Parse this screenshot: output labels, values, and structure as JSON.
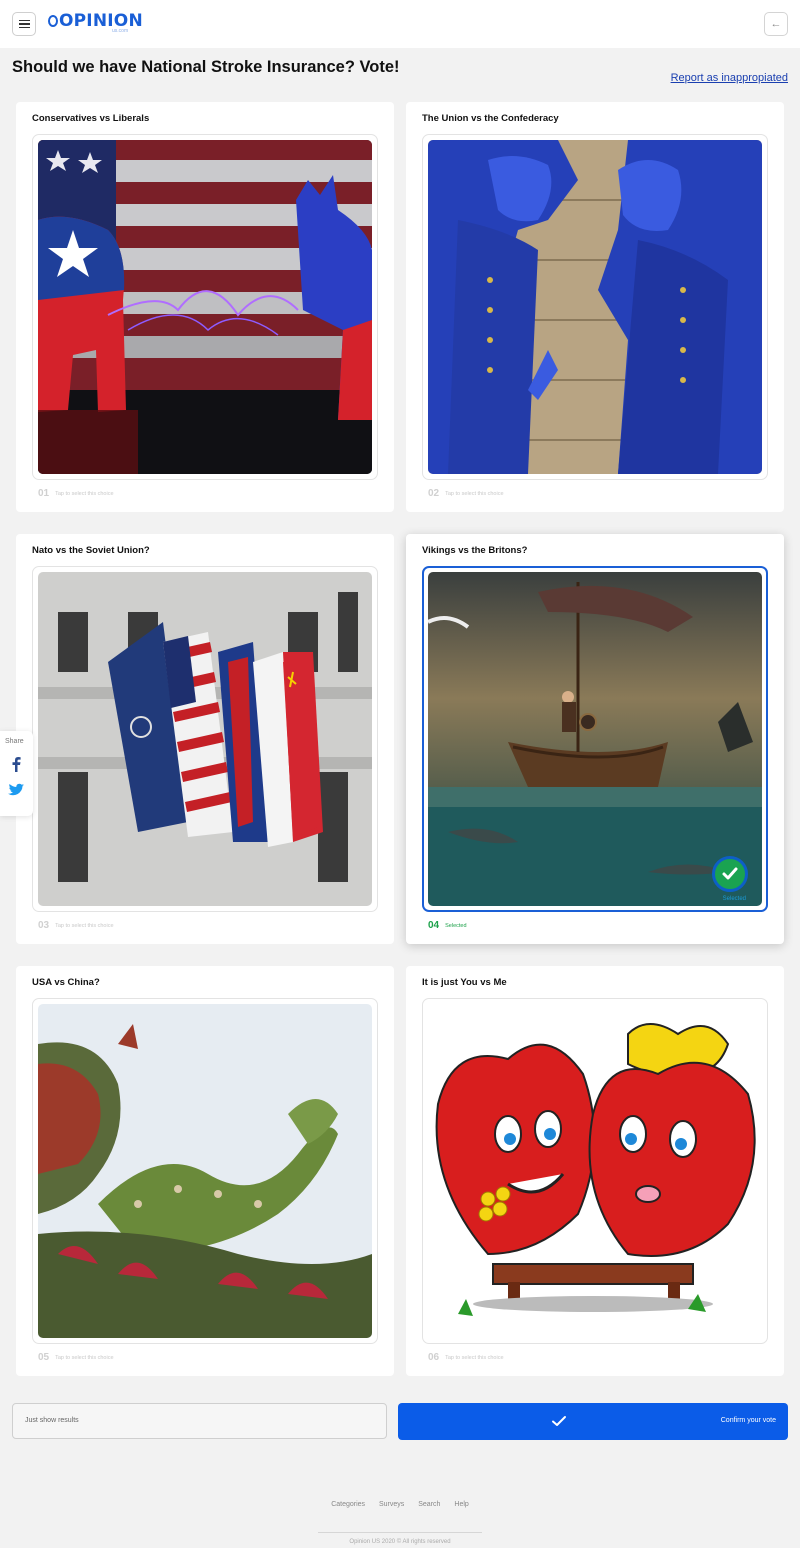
{
  "header": {
    "logo_text": "OPINION",
    "logo_sub": "us.com",
    "back_icon": "arrow-left-icon",
    "menu_icon": "hamburger-menu-icon"
  },
  "page": {
    "title": "Should we have National Stroke Insurance? Vote!",
    "report_link": "Report as inappropiated"
  },
  "choices": [
    {
      "number": "01",
      "title": "Conservatives vs Liberals",
      "hint": "Tap to select this choice",
      "image": "elephant-vs-donkey-flag"
    },
    {
      "number": "02",
      "title": "The Union vs the Confederacy",
      "hint": "Tap to select this choice",
      "image": "civil-war-mural"
    },
    {
      "number": "03",
      "title": "Nato vs the Soviet Union?",
      "hint": "Tap to select this choice",
      "image": "flags-on-building"
    },
    {
      "number": "04",
      "title": "Vikings vs the Britons?",
      "hint": "Selected",
      "image": "viking-ship-at-sea",
      "selected": true,
      "badge_label": "Selected"
    },
    {
      "number": "05",
      "title": "USA vs China?",
      "hint": "Tap to select this choice",
      "image": "dragon-sculpture"
    },
    {
      "number": "06",
      "title": "It is just You vs Me",
      "hint": "Tap to select this choice",
      "image": "cartoon-hearts"
    }
  ],
  "share": {
    "label": "Share",
    "icons": [
      "facebook-icon",
      "twitter-icon"
    ]
  },
  "actions": {
    "results_label": "Just show results",
    "confirm_label": "Confirm your vote"
  },
  "footer": {
    "links": [
      "Categories",
      "Surveys",
      "Search",
      "Help"
    ],
    "copyright": "Opinion US 2020 © All rights reserved"
  },
  "colors": {
    "accent": "#0b5ce8",
    "selected_green": "#1ca14a",
    "background": "#f2f2f2"
  }
}
